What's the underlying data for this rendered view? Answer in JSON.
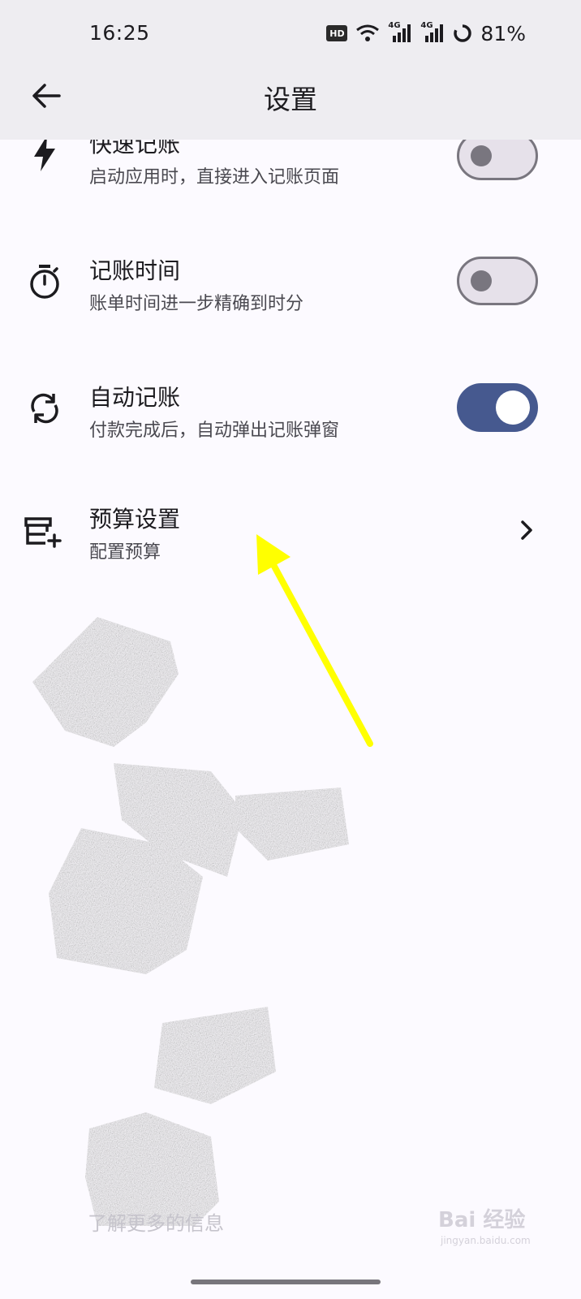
{
  "status_bar": {
    "time": "16:25",
    "hd_badge": "HD",
    "network_1": "4G",
    "network_2": "4G",
    "battery": "81%"
  },
  "app_bar": {
    "title": "设置",
    "back_icon": "arrow-left-icon"
  },
  "settings": [
    {
      "id": "quick-entry",
      "title": "快速记账",
      "subtitle": "启动应用时，直接进入记账页面",
      "icon": "lightning-icon",
      "control": "switch",
      "enabled": false
    },
    {
      "id": "entry-time",
      "title": "记账时间",
      "subtitle": "账单时间进一步精确到时分",
      "icon": "timer-icon",
      "control": "switch",
      "enabled": false
    },
    {
      "id": "auto-entry",
      "title": "自动记账",
      "subtitle": "付款完成后，自动弹出记账弹窗",
      "icon": "sync-icon",
      "control": "switch",
      "enabled": true
    },
    {
      "id": "budget",
      "title": "预算设置",
      "subtitle": "配置预算",
      "icon": "budget-add-icon",
      "control": "chevron"
    }
  ],
  "obscured_text": "了解更多的信息",
  "watermark": "Bai 经验",
  "watermark_sub": "jingyan.baidu.com",
  "colors": {
    "accent": "#46598f",
    "annotation_arrow": "#ffff00",
    "app_bar_bg": "#eeedf1",
    "page_bg": "#fcfaff"
  }
}
